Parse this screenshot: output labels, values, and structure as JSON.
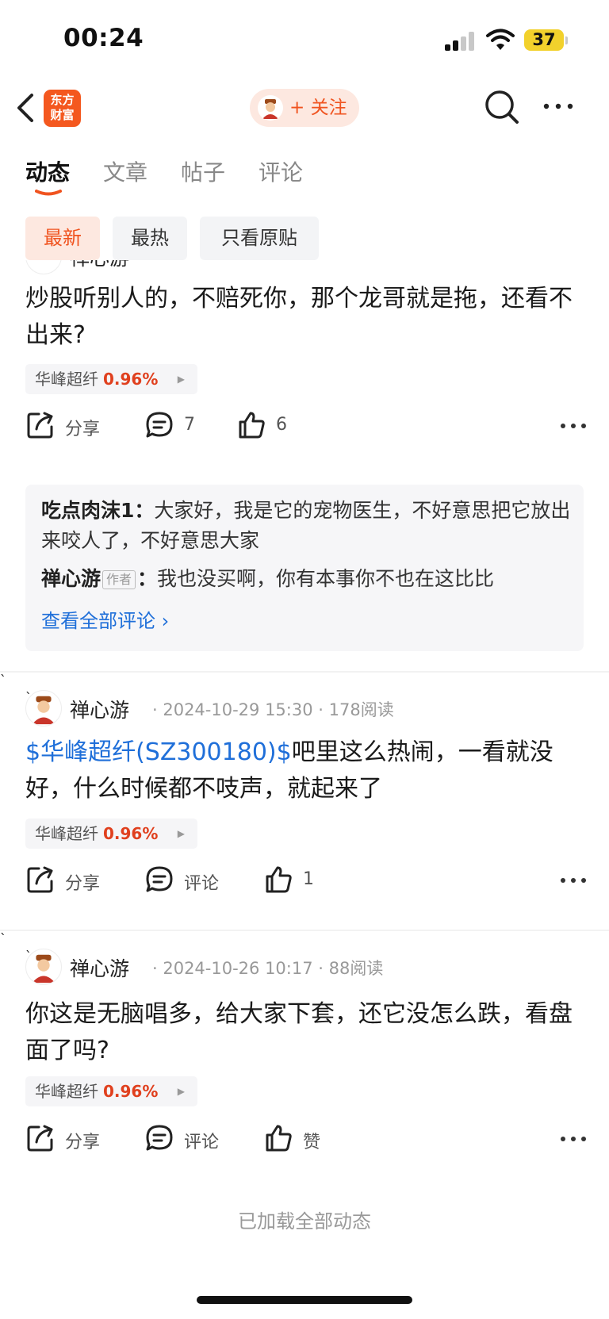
{
  "status": {
    "time": "00:24",
    "battery": "37"
  },
  "nav": {
    "logo_line1": "东方",
    "logo_line2": "财富",
    "follow_label": "+ 关注"
  },
  "tabs": [
    {
      "label": "动态",
      "active": true
    },
    {
      "label": "文章",
      "active": false
    },
    {
      "label": "帖子",
      "active": false
    },
    {
      "label": "评论",
      "active": false
    }
  ],
  "filters": [
    {
      "label": "最新",
      "active": true
    },
    {
      "label": "最热",
      "active": false
    },
    {
      "label": "只看原贴",
      "active": false
    }
  ],
  "posts": [
    {
      "author": "禅心游",
      "text": "炒股听别人的，不赔死你，那个龙哥就是拖，还看不出来?",
      "stock": {
        "name": "华峰超纤",
        "change": "0.96%"
      },
      "actions": {
        "share": "分享",
        "comment": "7",
        "like": "6"
      },
      "comments": [
        {
          "author": "吃点肉沫1",
          "text": "大家好，我是它的宠物医生，不好意思把它放出来咬人了，不好意思大家"
        },
        {
          "author": "禅心游",
          "badge": "作者",
          "text": "我也没买啊，你有本事你不也在这比比"
        }
      ],
      "view_all": "查看全部评论 ›"
    },
    {
      "author": "禅心游",
      "meta": "· 2024-10-29 15:30 · 178阅读",
      "link": "$华峰超纤(SZ300180)$",
      "text": "吧里这么热闹，一看就没好，什么时候都不吱声，就起来了",
      "stock": {
        "name": "华峰超纤",
        "change": "0.96%"
      },
      "actions": {
        "share": "分享",
        "comment": "评论",
        "like": "1"
      }
    },
    {
      "author": "禅心游",
      "meta": "· 2024-10-26 10:17 · 88阅读",
      "text": "你这是无脑唱多，给大家下套，还它没怎么跌，看盘面了吗?",
      "stock": {
        "name": "华峰超纤",
        "change": "0.96%"
      },
      "actions": {
        "share": "分享",
        "comment": "评论",
        "like": "赞"
      }
    }
  ],
  "footer": "已加载全部动态",
  "colors": {
    "accent": "#f0531f",
    "link": "#1f6fd9",
    "rise": "#e0401e",
    "battery": "#f2d12c"
  }
}
